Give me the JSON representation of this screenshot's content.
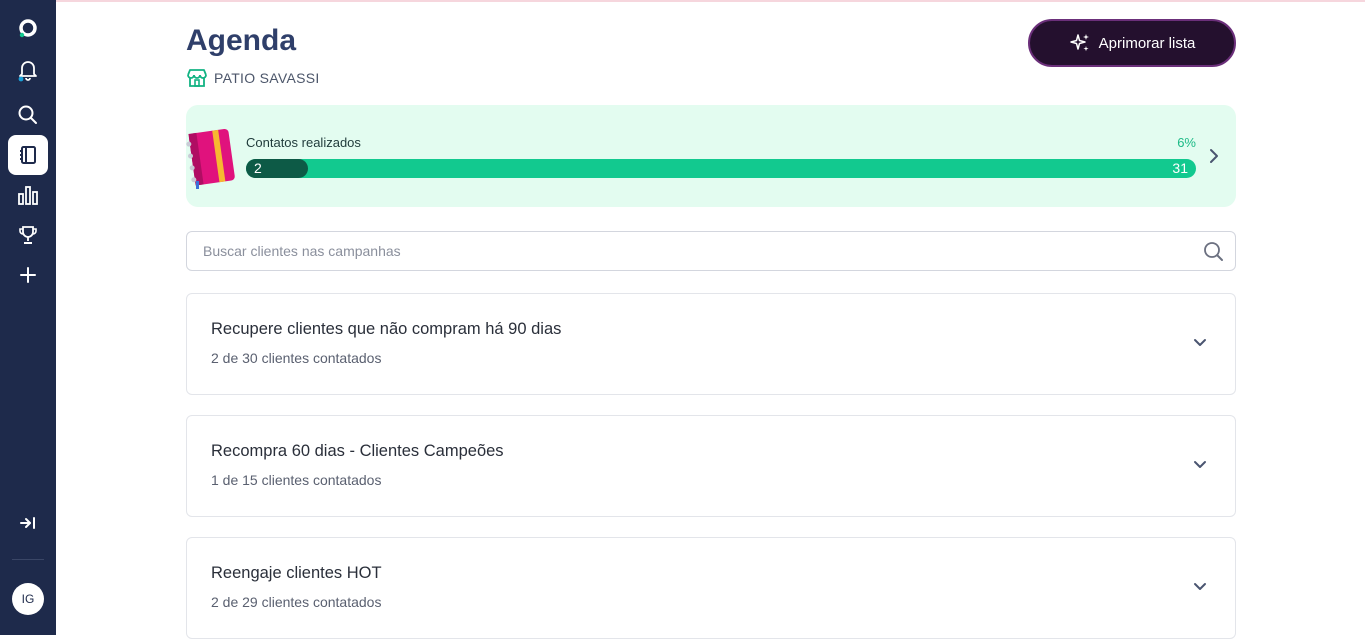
{
  "sidebar": {
    "items": [
      {
        "icon": "logo-icon"
      },
      {
        "icon": "bell-icon"
      },
      {
        "icon": "search-icon"
      },
      {
        "icon": "agenda-icon",
        "active": true
      },
      {
        "icon": "bar-chart-icon"
      },
      {
        "icon": "trophy-icon"
      },
      {
        "icon": "plus-icon"
      }
    ],
    "collapse_icon": "expand-sidebar-icon",
    "avatar_initials": "IG"
  },
  "header": {
    "title": "Agenda",
    "store_name": "PATIO SAVASSI",
    "improve_button": "Aprimorar lista"
  },
  "progress": {
    "label": "Contatos realizados",
    "percent": "6%",
    "done": "2",
    "total": "31",
    "fill_fraction": 0.065
  },
  "search": {
    "placeholder": "Buscar clientes nas campanhas",
    "value": ""
  },
  "campaigns": [
    {
      "title": "Recupere clientes que não compram há 90 dias",
      "subtitle": "2 de 30 clientes contatados"
    },
    {
      "title": "Recompra 60 dias - Clientes Campeões",
      "subtitle": "1 de 15 clientes contatados"
    },
    {
      "title": "Reengaje clientes HOT",
      "subtitle": "2 de 29 clientes contatados"
    }
  ],
  "colors": {
    "sidebar_bg": "#1e2a4b",
    "accent_green": "#12c98f",
    "dark_green": "#0d5a46",
    "button_bg": "#24102e"
  }
}
